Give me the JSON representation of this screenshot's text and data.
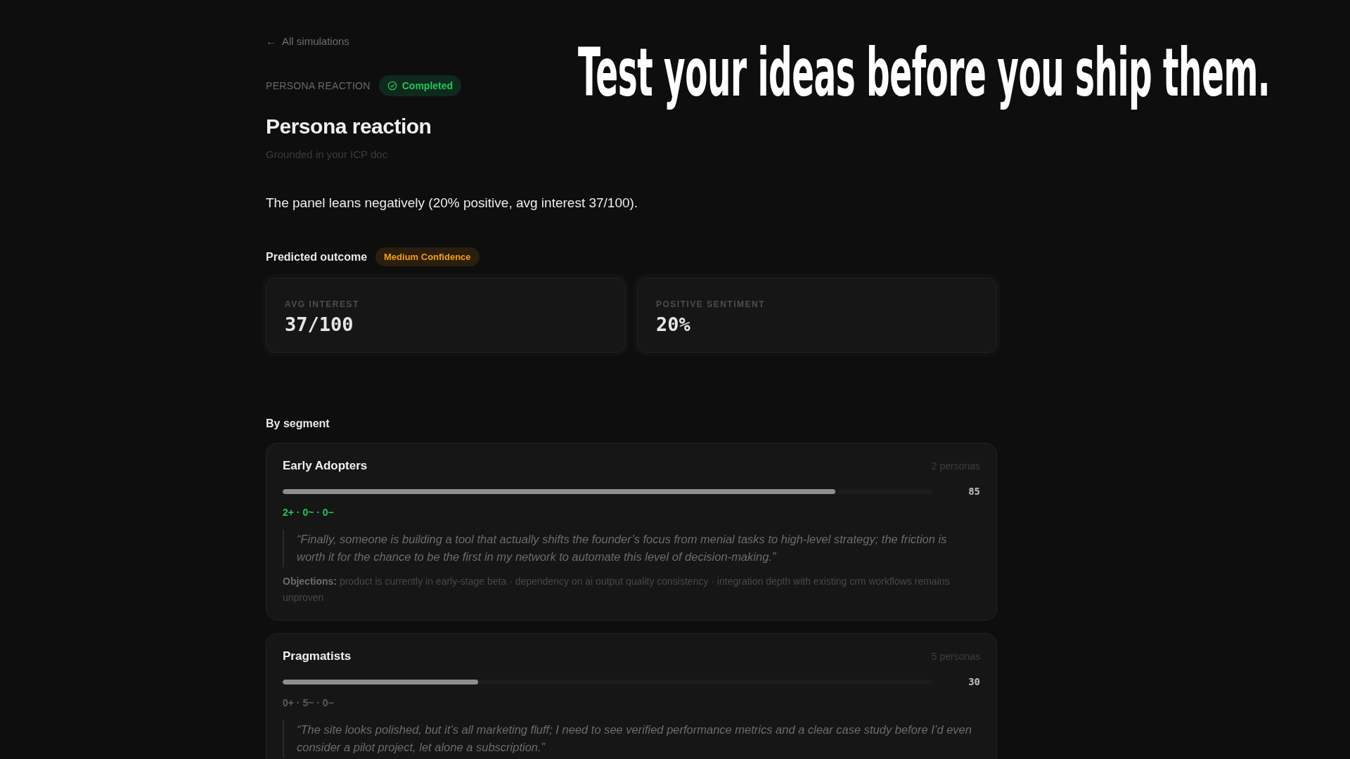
{
  "headline": "Test your ideas before you ship them.",
  "back_link": {
    "icon": "←",
    "label": "All simulations"
  },
  "header": {
    "eyebrow": "PERSONA REACTION",
    "status": "Completed",
    "title": "Persona reaction",
    "subtitle": "Grounded in your ICP doc"
  },
  "summary": "The panel leans negatively (20% positive, avg interest 37/100).",
  "predicted_outcome": {
    "label": "Predicted outcome",
    "confidence": "Medium Confidence"
  },
  "metrics": [
    {
      "label": "AVG INTEREST",
      "value": "37/100"
    },
    {
      "label": "POSITIVE SENTIMENT",
      "value": "20%"
    }
  ],
  "segments_title": "By segment",
  "segments": [
    {
      "name": "Early Adopters",
      "personas": "2 personas",
      "level": 0.85,
      "score": "85",
      "counts": "2+ · 0~ · 0−",
      "color": "#22c55e",
      "quote": "“Finally, someone is building a tool that actually shifts the founder’s focus from menial tasks to high-level strategy; the friction is worth it for the chance to be the first in my network to automate this level of decision-making.”",
      "objections_label": "Objections:",
      "objections": "product is currently in early-stage beta · dependency on ai output quality consistency · integration depth with existing crm workflows remains unproven"
    },
    {
      "name": "Pragmatists",
      "personas": "5 personas",
      "level": 0.3,
      "score": "30",
      "counts": "0+ · 5~ · 0−",
      "color": "#5c5c5c",
      "quote": "“The site looks polished, but it’s all marketing fluff; I need to see verified performance metrics and a clear case study before I’d even consider a pilot project, let alone a subscription.”"
    }
  ]
}
